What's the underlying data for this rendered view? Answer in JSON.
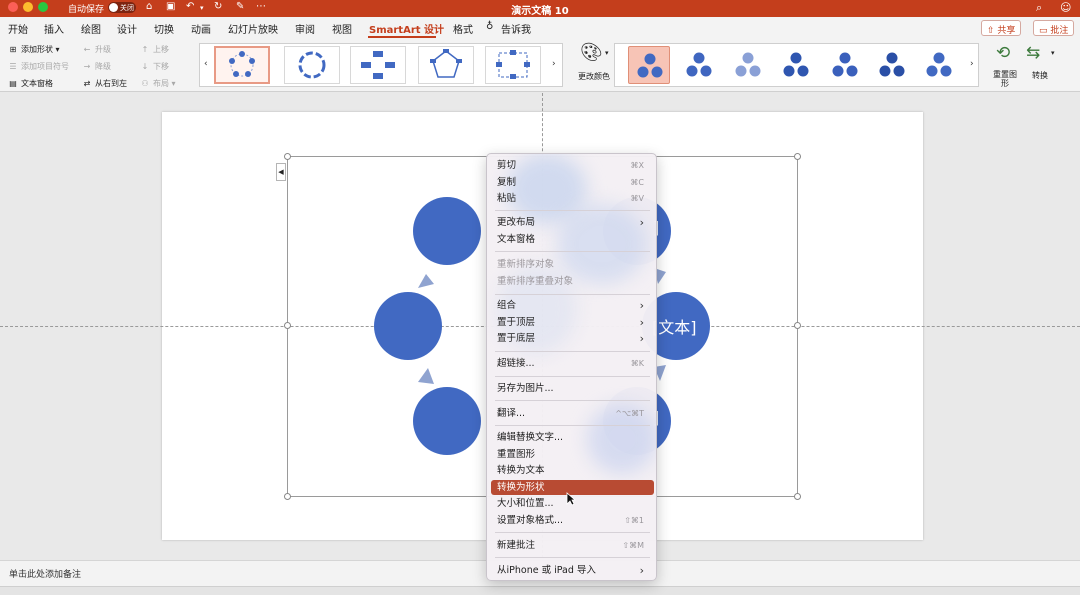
{
  "titlebar": {
    "autosave_label": "自动保存",
    "toggle_state": "关闭",
    "document_title": "演示文稿 10",
    "colors": {
      "bar": "#c43e1c"
    }
  },
  "tabs": [
    "开始",
    "插入",
    "绘图",
    "设计",
    "切换",
    "动画",
    "幻灯片放映",
    "审阅",
    "视图",
    "SmartArt 设计",
    "格式"
  ],
  "tell_me": "告诉我",
  "share_label": "共享",
  "comments_label": "批注",
  "ribbon": {
    "add_shape": "添加形状",
    "add_bullet": "添加项目符号",
    "text_pane": "文本窗格",
    "promote": "升级",
    "demote": "降级",
    "right_to_left": "从右到左",
    "move_up": "上移",
    "move_down": "下移",
    "layout": "布局",
    "change_colors": "更改颜色",
    "reset_graphic": "重置图形",
    "convert": "转换"
  },
  "slide": {
    "shape_texts": [
      "]",
      "[文本]",
      "]"
    ],
    "shape_color": "#4169c2"
  },
  "notes_placeholder": "单击此处添加备注",
  "context_menu": {
    "items": [
      {
        "label": "剪切",
        "shortcut": "⌘X"
      },
      {
        "label": "复制",
        "shortcut": "⌘C"
      },
      {
        "label": "粘贴",
        "shortcut": "⌘V"
      },
      {
        "label": "更改布局"
      },
      {
        "label": "文本窗格"
      },
      {
        "label": "重新排序对象"
      },
      {
        "label": "重新排序重叠对象"
      },
      {
        "label": "组合"
      },
      {
        "label": "置于顶层"
      },
      {
        "label": "置于底层"
      },
      {
        "label": "超链接...",
        "shortcut": "⌘K"
      },
      {
        "label": "另存为图片..."
      },
      {
        "label": "翻译...",
        "shortcut": "^⌥⌘T"
      },
      {
        "label": "编辑替换文字..."
      },
      {
        "label": "重置图形"
      },
      {
        "label": "转换为文本"
      },
      {
        "label": "转换为形状"
      },
      {
        "label": "大小和位置..."
      },
      {
        "label": "设置对象格式...",
        "shortcut": "⇧⌘1"
      },
      {
        "label": "新建批注",
        "shortcut": "⇧⌘M"
      },
      {
        "label": "从iPhone 或 iPad 导入"
      }
    ],
    "highlighted": "转换为形状",
    "highlight_color": "#b84b33"
  }
}
